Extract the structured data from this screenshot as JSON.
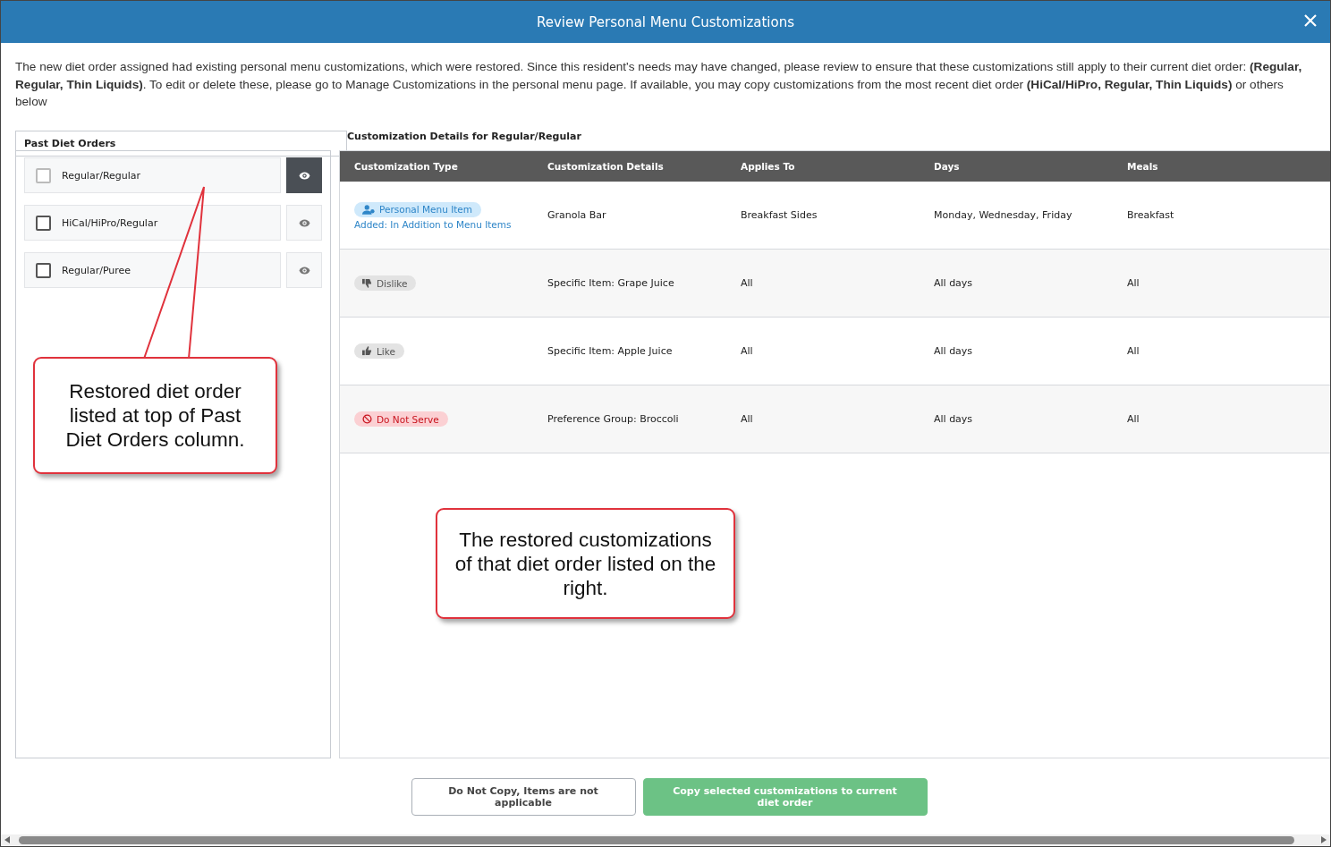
{
  "window": {
    "title": "Review Personal Menu Customizations"
  },
  "intro": "The new diet order assigned had existing personal menu customizations, which were restored. Since this resident's needs may have changed, please review to ensure that these customizations still apply to their current diet order: **(Regular, Regular, Thin Liquids)**. To edit or delete these, please go to Manage Customizations in the personal menu page. If available, you may copy customizations from the most recent diet order **(HiCal/HiPro, Regular, Thin Liquids)** or others below",
  "past_diet_orders": {
    "label": "Past Diet Orders",
    "items": [
      {
        "name": "Regular/Regular",
        "checked": false,
        "disabled": true,
        "selected": true
      },
      {
        "name": "HiCal/HiPro/Regular",
        "checked": false,
        "disabled": false,
        "selected": false
      },
      {
        "name": "Regular/Puree",
        "checked": false,
        "disabled": false,
        "selected": false
      }
    ]
  },
  "customizations": {
    "title": "Customization Details for Regular/Regular",
    "columns": [
      "Customization Type",
      "Customization Details",
      "Applies To",
      "Days",
      "Meals"
    ],
    "rows": [
      {
        "type": {
          "kind": "personal",
          "label": "Personal Menu Item",
          "note": "Added: In Addition to Menu Items"
        },
        "details": "Granola Bar",
        "applies_to": "Breakfast Sides",
        "days": "Monday, Wednesday, Friday",
        "meals": "Breakfast"
      },
      {
        "type": {
          "kind": "dislike",
          "label": "Dislike"
        },
        "details": "Specific Item: Grape Juice",
        "applies_to": "All",
        "days": "All days",
        "meals": "All"
      },
      {
        "type": {
          "kind": "like",
          "label": "Like"
        },
        "details": "Specific Item: Apple Juice",
        "applies_to": "All",
        "days": "All days",
        "meals": "All"
      },
      {
        "type": {
          "kind": "do_not_serve",
          "label": "Do Not Serve"
        },
        "details": "Preference Group: Broccoli",
        "applies_to": "All",
        "days": "All days",
        "meals": "All"
      }
    ]
  },
  "callouts": [
    {
      "text": "Restored diet order listed at top of Past Diet Orders column."
    },
    {
      "text": "The restored customizations of that diet order listed on the right."
    }
  ],
  "buttons": [
    {
      "label": "Do Not Copy, Items are not applicable",
      "kind": "secondary"
    },
    {
      "label": "Copy selected customizations to current diet order",
      "kind": "primary"
    }
  ]
}
